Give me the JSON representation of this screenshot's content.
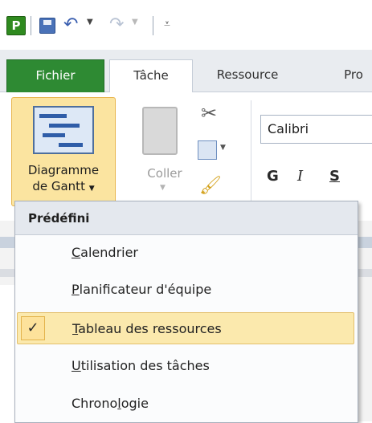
{
  "qat": {
    "app_icon": "P",
    "icons": [
      "project-icon",
      "save-icon",
      "undo-icon",
      "redo-icon",
      "customize-icon"
    ]
  },
  "tabs": {
    "file": "Fichier",
    "task": "Tâche",
    "resource": "Ressource",
    "project_partial": "Pro"
  },
  "ribbon": {
    "gantt_label_line1": "Diagramme",
    "gantt_label_line2": "de Gantt",
    "paste_label": "Coller",
    "font_name": "Calibri",
    "bold": "G",
    "italic": "I",
    "underline": "S"
  },
  "menu": {
    "header": "Prédéfini",
    "items": [
      {
        "before": "",
        "key": "C",
        "after": "alendrier"
      },
      {
        "before": "",
        "key": "P",
        "after": "lanificateur d'équipe"
      },
      {
        "before": "",
        "key": "T",
        "after": "ableau des ressources"
      },
      {
        "before": "",
        "key": "U",
        "after": "tilisation des tâches"
      },
      {
        "before": "Chrono",
        "key": "l",
        "after": "ogie"
      }
    ],
    "selected_index": 2,
    "check_glyph": "✓"
  },
  "colors": {
    "file_tab": "#2e8a33",
    "highlight": "#fbe4a0",
    "highlight_border": "#e8b54d"
  }
}
